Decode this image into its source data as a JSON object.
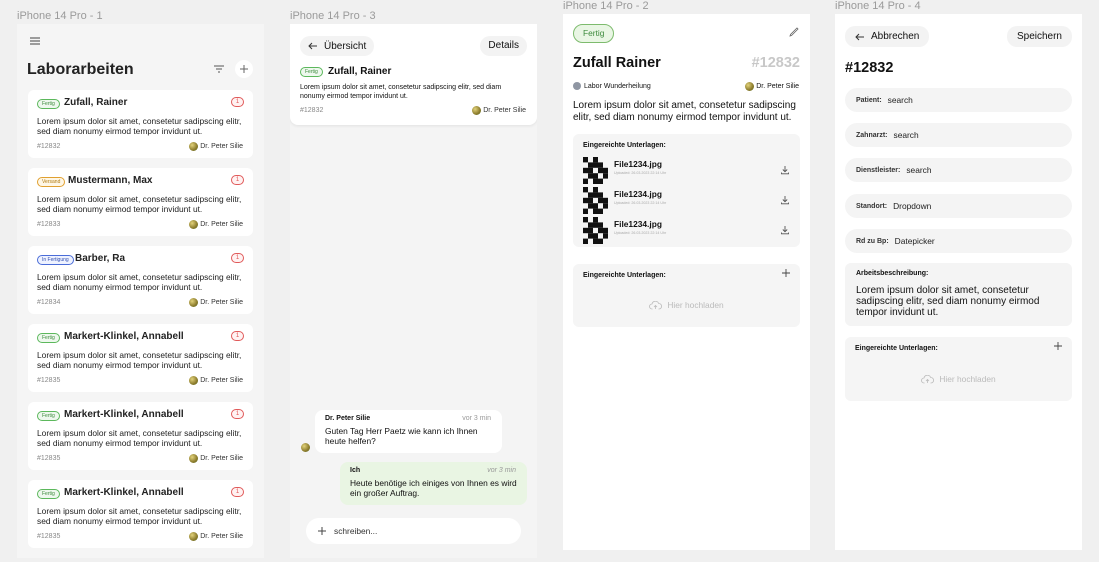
{
  "frame_labels": [
    "iPhone 14 Pro - 1",
    "iPhone 14 Pro - 3",
    "iPhone 14 Pro - 2",
    "iPhone 14 Pro - 4"
  ],
  "list": {
    "title": "Laborarbeiten",
    "cards": [
      {
        "badge": "Fertig",
        "name": "Zufall, Rainer",
        "count": "1",
        "desc": "Lorem ipsum dolor sit amet, consetetur sadipscing elitr, sed diam nonumy eirmod tempor invidunt ut.",
        "id": "#12832",
        "doctor": "Dr. Peter Silie"
      },
      {
        "badge": "Versand",
        "name": "Mustermann, Max",
        "count": "1",
        "desc": "Lorem ipsum dolor sit amet, consetetur sadipscing elitr, sed diam nonumy eirmod tempor invidunt ut.",
        "id": "#12833",
        "doctor": "Dr. Peter Silie"
      },
      {
        "badge": "In Fertigung",
        "name": "Barber, Ra",
        "count": "1",
        "desc": "Lorem ipsum dolor sit amet, consetetur sadipscing elitr, sed diam nonumy eirmod tempor invidunt ut.",
        "id": "#12834",
        "doctor": "Dr. Peter Silie"
      },
      {
        "badge": "Fertig",
        "name": "Markert-Klinkel, Annabell",
        "count": "1",
        "desc": "Lorem ipsum dolor sit amet, consetetur sadipscing elitr, sed diam nonumy eirmod tempor invidunt ut.",
        "id": "#12835",
        "doctor": "Dr. Peter Silie"
      },
      {
        "badge": "Fertig",
        "name": "Markert-Klinkel, Annabell",
        "count": "1",
        "desc": "Lorem ipsum dolor sit amet, consetetur sadipscing elitr, sed diam nonumy eirmod tempor invidunt ut.",
        "id": "#12835",
        "doctor": "Dr. Peter Silie"
      },
      {
        "badge": "Fertig",
        "name": "Markert-Klinkel, Annabell",
        "count": "1",
        "desc": "Lorem ipsum dolor sit amet, consetetur sadipscing elitr, sed diam nonumy eirmod tempor invidunt ut.",
        "id": "#12835",
        "doctor": "Dr. Peter Silie"
      }
    ]
  },
  "chat": {
    "back_label": "Übersicht",
    "details_label": "Details",
    "badge": "Fertig",
    "name": "Zufall, Rainer",
    "desc": "Lorem ipsum dolor sit amet, consetetur sadipscing elitr, sed diam nonumy eirmod tempor invidunt ut.",
    "id": "#12832",
    "doctor": "Dr. Peter Silie",
    "messages": [
      {
        "from": "Dr. Peter Silie",
        "time": "vor 3 min",
        "text": "Guten Tag Herr Paetz wie kann ich Ihnen heute helfen?"
      },
      {
        "from": "Ich",
        "time": "vor 3 min",
        "text": "Heute benötige ich einiges von Ihnen es wird ein großer Auftrag."
      }
    ],
    "input_placeholder": "schreiben..."
  },
  "detail": {
    "status": "Fertig",
    "name": "Zufall Rainer",
    "id": "#12832",
    "lab": "Labor Wunderheilung",
    "doctor": "Dr. Peter Silie",
    "desc": "Lorem ipsum dolor sit amet, consetetur sadipscing elitr, sed diam nonumy eirmod tempor invidunt ut.",
    "files_title": "Eingereichte Unterlagen:",
    "files": [
      {
        "name": "File1234.jpg",
        "uploaded": "Uploaded: 26.03.2023 22:14 Uhr"
      },
      {
        "name": "File1234.jpg",
        "uploaded": "Uploaded: 26.03.2023 22:14 Uhr"
      },
      {
        "name": "File1234.jpg",
        "uploaded": "Uploaded: 26.03.2023 22:14 Uhr"
      }
    ],
    "upload_title": "Eingereichte Unterlagen:",
    "upload_label": "Hier hochladen"
  },
  "edit": {
    "cancel_label": "Abbrechen",
    "save_label": "Speichern",
    "title": "#12832",
    "fields": [
      {
        "label": "Patient:",
        "value": "search"
      },
      {
        "label": "Zahnarzt:",
        "value": "search"
      },
      {
        "label": "Dienstleister:",
        "value": "search"
      },
      {
        "label": "Standort:",
        "value": "Dropdown"
      },
      {
        "label": "Rd zu Bp:",
        "value": "Datepicker"
      }
    ],
    "work_label": "Arbeitsbeschreibung:",
    "work_text": "Lorem ipsum dolor sit amet, consetetur sadipscing elitr, sed diam nonumy eirmod tempor invidunt ut.",
    "upload_title": "Eingereichte Unterlagen:",
    "upload_label": "Hier hochladen"
  },
  "colors": {
    "fertig": "#5cb85c",
    "versand": "#e0a030",
    "in_fertigung": "#4a6cd8",
    "count": "#e05a5a"
  }
}
